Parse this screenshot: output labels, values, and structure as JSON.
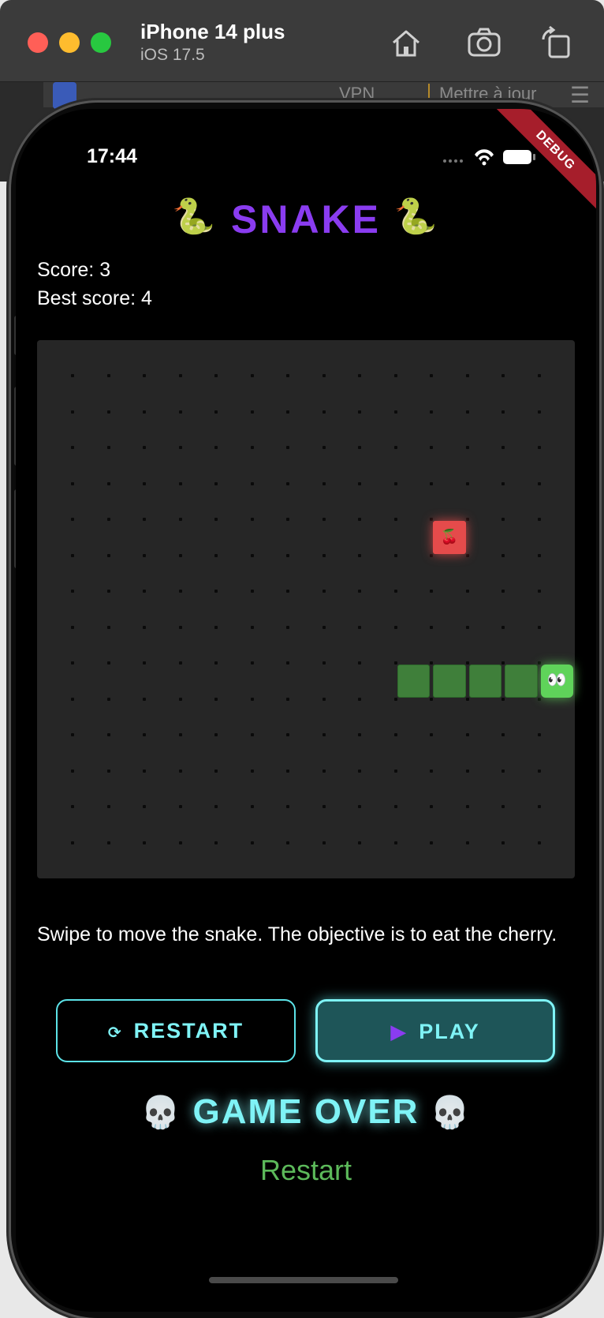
{
  "simulator": {
    "device_name": "iPhone 14 plus",
    "os_version": "iOS 17.5",
    "toolbar_icons": [
      "home-icon",
      "screenshot-camera-icon",
      "rotate-icon"
    ]
  },
  "background_browser": {
    "vpn_label": "VPN",
    "update_label": "Mettre à jour"
  },
  "status_bar": {
    "time": "17:44",
    "debug_label": "DEBUG"
  },
  "game": {
    "title": "SNAKE",
    "title_emoji": "🐍",
    "score_text": "Score: 3",
    "best_score_text": "Best score: 4",
    "instructions": "Swipe to move the snake. The objective is to eat the cherry.",
    "board": {
      "grid_columns": 15,
      "grid_rows": 15,
      "food": {
        "col": 11,
        "row": 5,
        "icon": "🍒"
      },
      "snake": [
        {
          "col": 14,
          "row": 9,
          "part": "head",
          "icon": "👀"
        },
        {
          "col": 13,
          "row": 9,
          "part": "body"
        },
        {
          "col": 12,
          "row": 9,
          "part": "body"
        },
        {
          "col": 11,
          "row": 9,
          "part": "body"
        },
        {
          "col": 10,
          "row": 9,
          "part": "body"
        }
      ],
      "colors": {
        "board": "#262626",
        "snake_body": "#3f7f3a",
        "snake_head": "#5fd35a",
        "food": "#e54b4b"
      }
    },
    "buttons": {
      "restart_label": "RESTART",
      "restart_icon": "⟳",
      "play_label": "PLAY",
      "play_icon": "▶"
    },
    "game_over_text": "GAME OVER",
    "game_over_emoji": "💀",
    "restart_link": "Restart",
    "accent_colors": {
      "title": "#8a3cf0",
      "neon": "#7ff3f6",
      "restart_link": "#5cb95a"
    }
  }
}
